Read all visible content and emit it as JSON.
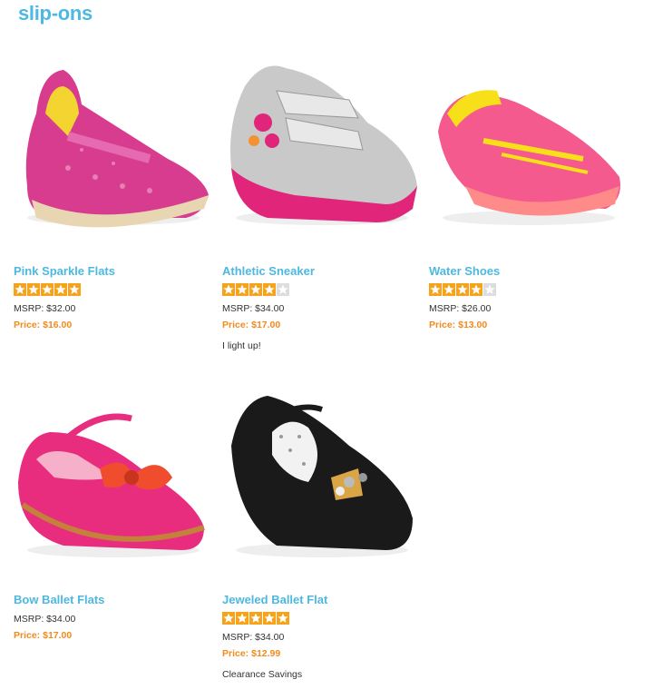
{
  "page": {
    "title": "slip-ons"
  },
  "products": [
    {
      "name": "Pink Sparkle Flats",
      "rating": 5,
      "msrp": "MSRP: $32.00",
      "price": "Price: $16.00",
      "note": ""
    },
    {
      "name": "Athletic Sneaker",
      "rating": 4,
      "msrp": "MSRP: $34.00",
      "price": "Price: $17.00",
      "note": "I light up!"
    },
    {
      "name": "Water Shoes",
      "rating": 4,
      "msrp": "MSRP: $26.00",
      "price": "Price: $13.00",
      "note": ""
    },
    {
      "name": "Bow Ballet Flats",
      "rating": 0,
      "msrp": "MSRP: $34.00",
      "price": "Price: $17.00",
      "note": ""
    },
    {
      "name": "Jeweled Ballet Flat",
      "rating": 5,
      "msrp": "MSRP: $34.00",
      "price": "Price: $12.99",
      "note": "Clearance Savings"
    }
  ],
  "colors": {
    "accent": "#4db8e0",
    "price": "#f28a1c",
    "star_filled": "#f7a21b",
    "star_empty": "#dddddd"
  }
}
